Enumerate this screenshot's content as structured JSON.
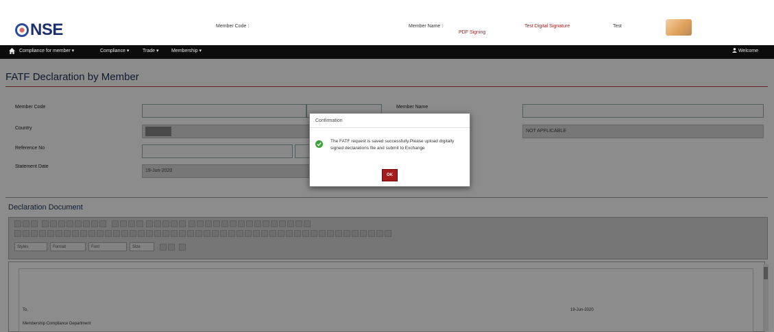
{
  "header": {
    "logo_text": "NSE",
    "member_code_label": "Member Code :",
    "member_name_label": "Member Name :",
    "pdf_signing": "PDF Signing",
    "test_digital_signature": "Test Digital Signature",
    "test_label": "Test"
  },
  "nav": {
    "items": [
      "Compliance for member",
      "Compliance",
      "Trade",
      "Membership"
    ],
    "welcome": "Welcome"
  },
  "page": {
    "title": "FATF Declaration by Member"
  },
  "form": {
    "member_code_label": "Member Code",
    "member_name_label": "Member Name",
    "country_label": "Country",
    "country_right_value": "NOT APPLICABLE",
    "reference_label": "Reference No",
    "statement_date_label": "Statement Date",
    "statement_date_value": "19-Jun-2020"
  },
  "document": {
    "title": "Declaration Document",
    "toolbar_combos": [
      "Styles",
      "Format",
      "Font",
      "Size"
    ],
    "to_label": "To,",
    "date_value": "19-Jun-2020",
    "recipient": "Membership Compliance Department"
  },
  "modal": {
    "title": "Confirmation",
    "message": "The FATF request is saved successfully.Please upload digitally signed declarations file and submit to Exchange",
    "ok_label": "OK"
  },
  "colors": {
    "nav_bg": "#0c0c0c",
    "ok_button": "#a51c1c",
    "success_icon": "#3aa335",
    "title_rule": "#bb4444"
  }
}
